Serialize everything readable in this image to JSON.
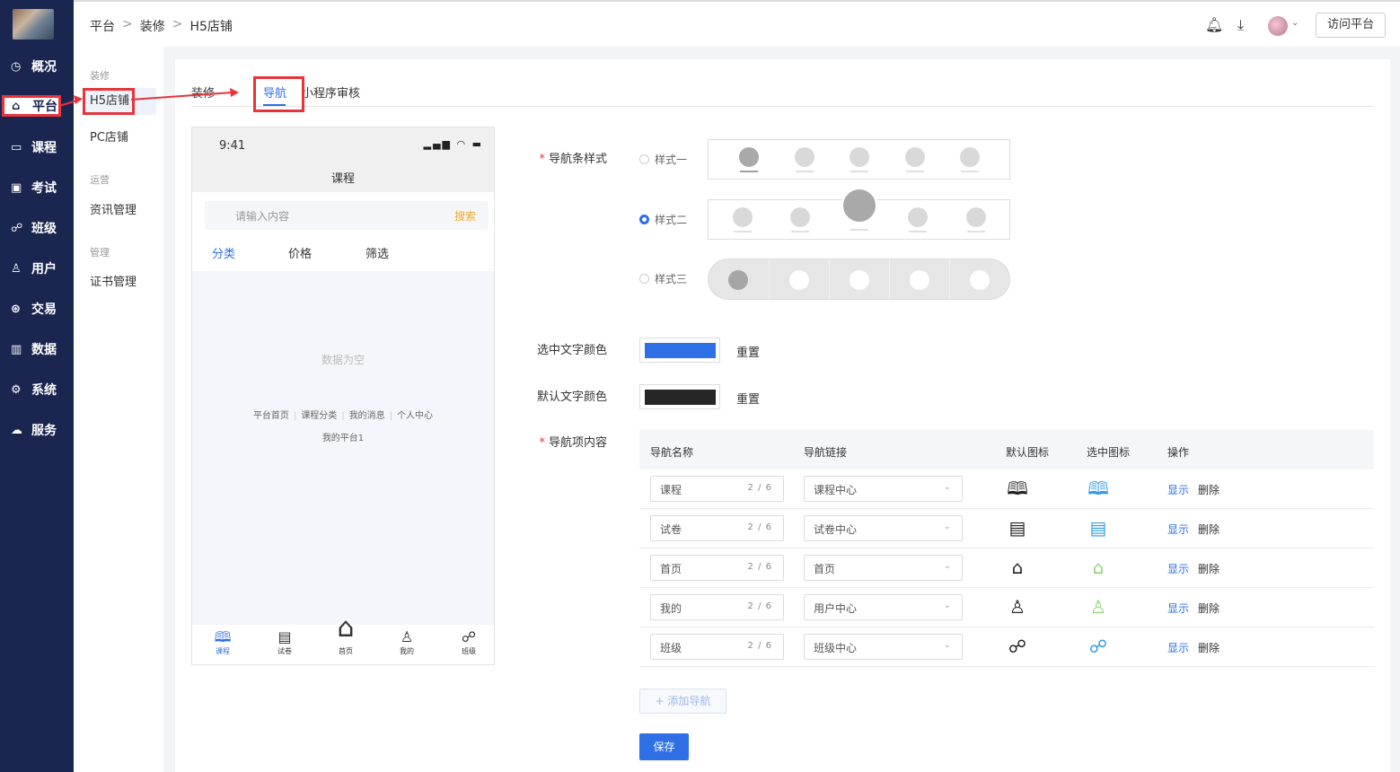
{
  "sidebar": {
    "items": [
      {
        "label": "概况",
        "icon": "clock-icon",
        "glyph": "◷"
      },
      {
        "label": "平台",
        "icon": "shop-icon",
        "glyph": "⌂"
      },
      {
        "label": "课程",
        "icon": "book-icon",
        "glyph": "▭"
      },
      {
        "label": "考试",
        "icon": "exam-icon",
        "glyph": "▣"
      },
      {
        "label": "班级",
        "icon": "group-icon",
        "glyph": "☍"
      },
      {
        "label": "用户",
        "icon": "user-icon",
        "glyph": "♙"
      },
      {
        "label": "交易",
        "icon": "trade-icon",
        "glyph": "⊛"
      },
      {
        "label": "数据",
        "icon": "chart-icon",
        "glyph": "▥"
      },
      {
        "label": "系统",
        "icon": "gear-icon",
        "glyph": "⚙"
      },
      {
        "label": "服务",
        "icon": "service-icon",
        "glyph": "☁"
      }
    ]
  },
  "subnav": {
    "group_decorate": "装修",
    "h5": "H5店铺",
    "pc": "PC店铺",
    "group_ops": "运营",
    "news": "资讯管理",
    "group_manage": "管理",
    "cert": "证书管理"
  },
  "header": {
    "crumb1": "平台",
    "crumb2": "装修",
    "crumb3": "H5店铺",
    "sep": ">",
    "visit": "访问平台"
  },
  "tabs": {
    "t1": "装修",
    "t2": "导航",
    "t3": "小程序审核"
  },
  "phone": {
    "time": "9:41",
    "signal": "▂▄▆ ◠ ▬",
    "title": "课程",
    "search_placeholder": "请输入内容",
    "search_btn": "搜索",
    "filters": [
      "分类",
      "价格",
      "筛选"
    ],
    "empty": "数据为空",
    "links": [
      "平台首页",
      "课程分类",
      "我的消息",
      "个人中心"
    ],
    "copyright": "我的平台1",
    "tabbar": [
      {
        "label": "课程",
        "glyph": "🕮"
      },
      {
        "label": "试卷",
        "glyph": "▤"
      },
      {
        "label": "首页",
        "glyph": "⌂"
      },
      {
        "label": "我的",
        "glyph": "♙"
      },
      {
        "label": "班级",
        "glyph": "☍"
      }
    ]
  },
  "form": {
    "style_label": "导航条样式",
    "style_options": [
      "样式一",
      "样式二",
      "样式三"
    ],
    "selected_style": "样式二",
    "active_color_label": "选中文字颜色",
    "active_color": "#2f6fe6",
    "default_color_label": "默认文字颜色",
    "default_color": "#262626",
    "reset": "重置",
    "items_label": "导航项内容",
    "add_btn": "+ 添加导航",
    "save_btn": "保存"
  },
  "table": {
    "headers": [
      "导航名称",
      "导航链接",
      "默认图标",
      "选中图标",
      "操作"
    ],
    "rows": [
      {
        "name": "课程",
        "count": "2 / 6",
        "link": "课程中心",
        "icon_default": "🕮",
        "icon_active": "🕮",
        "active_color": "#2f9be6",
        "show": "显示",
        "del": "删除"
      },
      {
        "name": "试卷",
        "count": "2 / 6",
        "link": "试卷中心",
        "icon_default": "▤",
        "icon_active": "▤",
        "active_color": "#2f9be6",
        "show": "显示",
        "del": "删除"
      },
      {
        "name": "首页",
        "count": "2 / 6",
        "link": "首页",
        "icon_default": "⌂",
        "icon_active": "⌂",
        "active_color": "#8fd67a",
        "show": "显示",
        "del": "删除"
      },
      {
        "name": "我的",
        "count": "2 / 6",
        "link": "用户中心",
        "icon_default": "♙",
        "icon_active": "♙",
        "active_color": "#8fd67a",
        "show": "显示",
        "del": "删除"
      },
      {
        "name": "班级",
        "count": "2 / 6",
        "link": "班级中心",
        "icon_default": "☍",
        "icon_active": "☍",
        "active_color": "#2f9be6",
        "show": "显示",
        "del": "删除"
      }
    ]
  }
}
